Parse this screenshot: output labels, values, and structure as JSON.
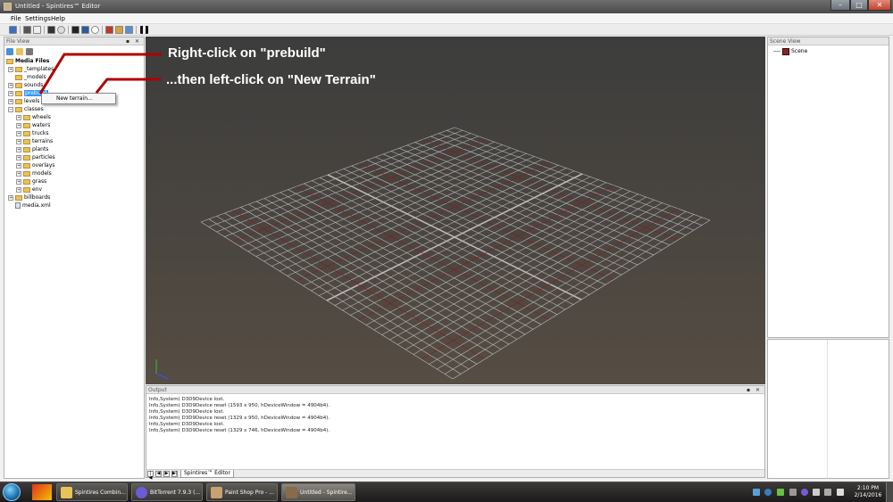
{
  "window": {
    "title": "Untitled - Spintires™ Editor",
    "min": "–",
    "max": "□",
    "close": "✕"
  },
  "menu": [
    "File",
    "Settings",
    "Help"
  ],
  "file_view": {
    "title": "File View",
    "controls": "▪ ✕",
    "root": "Media Files",
    "items": [
      {
        "label": "_templates",
        "expander": "+"
      },
      {
        "label": "_models",
        "expander": ""
      },
      {
        "label": "sounds",
        "expander": "+"
      },
      {
        "label": "prebuild",
        "expander": "+"
      },
      {
        "label": "levels",
        "expander": "+"
      },
      {
        "label": "classes",
        "expander": "−"
      },
      {
        "label": "wheels",
        "expander": "+"
      },
      {
        "label": "waters",
        "expander": "+"
      },
      {
        "label": "trucks",
        "expander": "+"
      },
      {
        "label": "terrains",
        "expander": "+"
      },
      {
        "label": "plants",
        "expander": "+"
      },
      {
        "label": "particles",
        "expander": "+"
      },
      {
        "label": "overlays",
        "expander": "+"
      },
      {
        "label": "models",
        "expander": "+"
      },
      {
        "label": "grass",
        "expander": "+"
      },
      {
        "label": "env",
        "expander": "+"
      },
      {
        "label": "billboards",
        "expander": "+"
      },
      {
        "label": "media.xml",
        "expander": ""
      }
    ]
  },
  "context_menu": {
    "item": "New terrain..."
  },
  "annotations": {
    "line1": "Right-click on \"prebuild\"",
    "line2": "...then left-click on \"New Terrain\"",
    "color": "#b00000"
  },
  "scene_view": {
    "title": "Scene View",
    "controls": "▪ ✕",
    "root": "Scene"
  },
  "output": {
    "title": "Output",
    "controls": "▪ ✕",
    "lines": [
      "Info,System( D3D9Device lost.",
      "Info,System( D3D9Device reset (1593 x 950, hDeviceWindow = 4904b4).",
      "Info,System( D3D9Device lost.",
      "Info,System( D3D9Device reset (1329 x 950, hDeviceWindow = 4904b4).",
      "Info,System( D3D9Device lost.",
      "Info,System( D3D9Device reset (1329 x 746, hDeviceWindow = 4904b4)."
    ],
    "nav": [
      "|◀",
      "◀",
      "▶",
      "▶|"
    ],
    "tab": "Spintires™ Editor"
  },
  "taskbar": {
    "tasks": [
      {
        "label": "Spintires Combin...",
        "icon_color": "#e8c35a"
      },
      {
        "label": "BitTorrent 7.9.3  (...",
        "icon_color": "#6b5bd6"
      },
      {
        "label": "Paint Shop Pro - ...",
        "icon_color": "#c9a070"
      },
      {
        "label": "Untitled - Spintire...",
        "icon_color": "#8a6a4a"
      }
    ],
    "time": "2:10 PM",
    "date": "2/14/2016"
  },
  "colors": {
    "selection": "#3399ff",
    "grid_line": "#b9b9b9",
    "grid_red": "#8b1a1a"
  }
}
